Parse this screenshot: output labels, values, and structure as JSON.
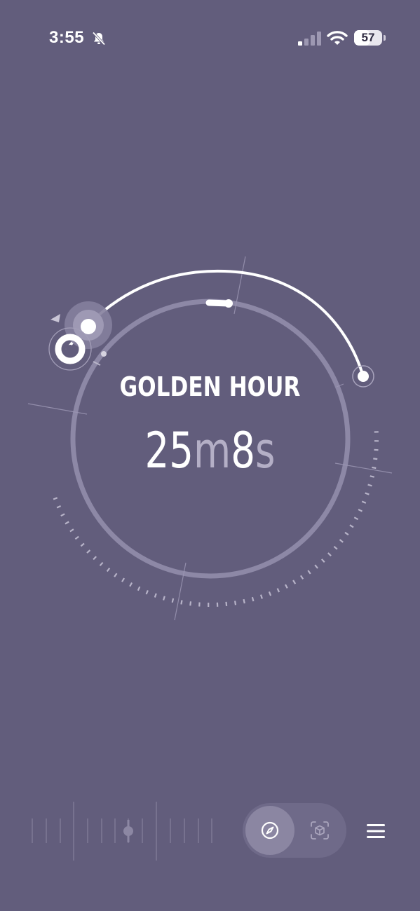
{
  "status_bar": {
    "time": "3:55",
    "battery": "57",
    "battery_level": 0.57,
    "icons": [
      "bell-slash-icon",
      "cellular-signal-icon",
      "wifi-icon",
      "battery-icon"
    ]
  },
  "main": {
    "title": "GOLDEN HOUR",
    "countdown": {
      "minutes": "25",
      "minutes_unit": "m",
      "seconds": "8",
      "seconds_unit": "s"
    }
  },
  "dial": {
    "icons": [
      "sun-position-marker-icon",
      "user-location-marker-icon",
      "direction-arrow-icon"
    ]
  },
  "bottom_bar": {
    "modes": [
      {
        "name": "compass",
        "icon": "compass-icon",
        "selected": true
      },
      {
        "name": "ar-view",
        "icon": "ar-cube-icon",
        "selected": false
      }
    ],
    "menu_icon": "menu-icon"
  },
  "colors": {
    "background": "#625d7c",
    "accent": "#ffffff",
    "muted": "#b4afc6",
    "ring": "#8d88a6"
  }
}
